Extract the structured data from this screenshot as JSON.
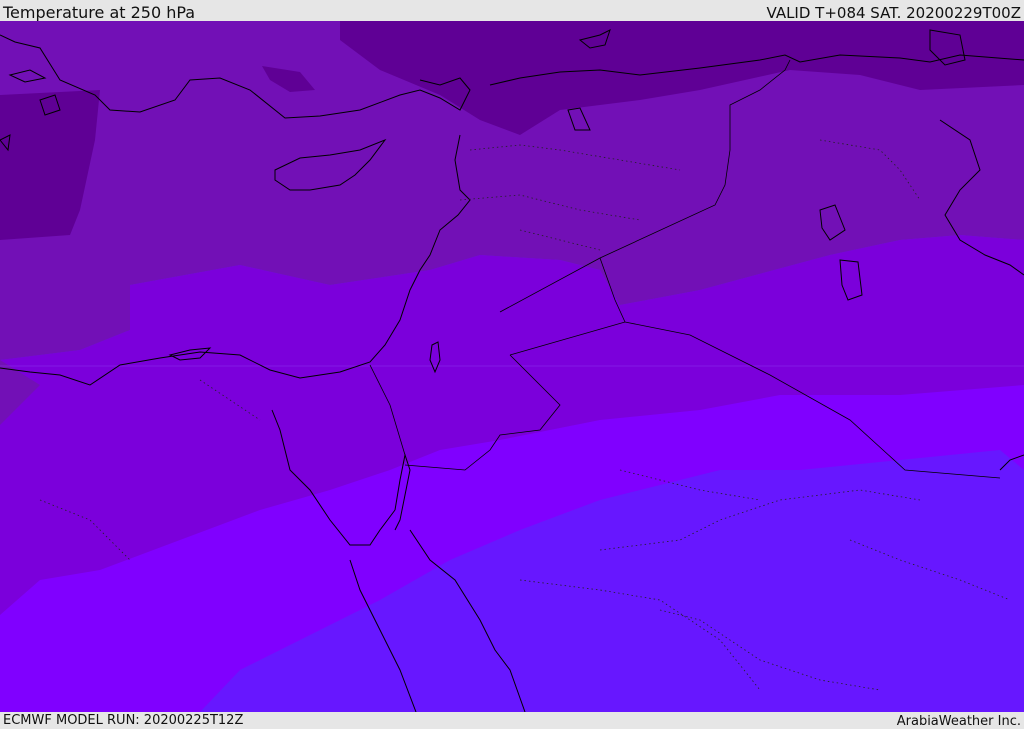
{
  "header": {
    "title": "Temperature at 250 hPa",
    "valid": "VALID T+084 SAT. 20200229T00Z"
  },
  "footer": {
    "model_run": "ECMWF MODEL RUN: 20200225T12Z",
    "credit": "ArabiaWeather Inc."
  },
  "map": {
    "field": "temperature",
    "pressure_level_hpa": 250,
    "band_colors": [
      "#5f0095",
      "#7210b6",
      "#7b00db",
      "#8000ff",
      "#6717ff"
    ],
    "coastline_color": "#000000",
    "border_style": "solid",
    "internal_border_style": "dotted"
  }
}
